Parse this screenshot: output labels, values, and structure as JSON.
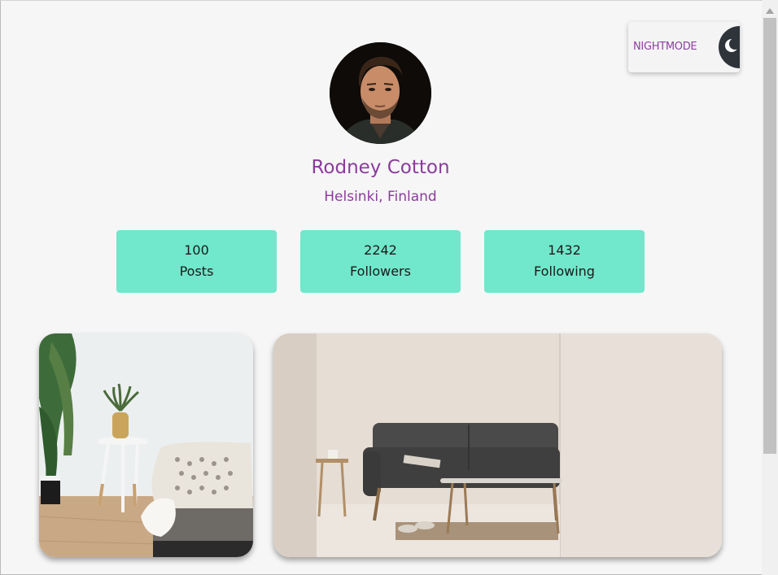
{
  "nightmode": {
    "label": "NIGHTMODE",
    "icon": "moon-icon"
  },
  "profile": {
    "name": "Rodney Cotton",
    "location": "Helsinki, Finland"
  },
  "stats": [
    {
      "value": "100",
      "label": "Posts"
    },
    {
      "value": "2242",
      "label": "Followers"
    },
    {
      "value": "1432",
      "label": "Following"
    }
  ],
  "colors": {
    "accent": "#8b3c9c",
    "stat_bg": "#71e7cb",
    "background": "#f6f6f7",
    "toggle_knob": "#2f343b"
  }
}
